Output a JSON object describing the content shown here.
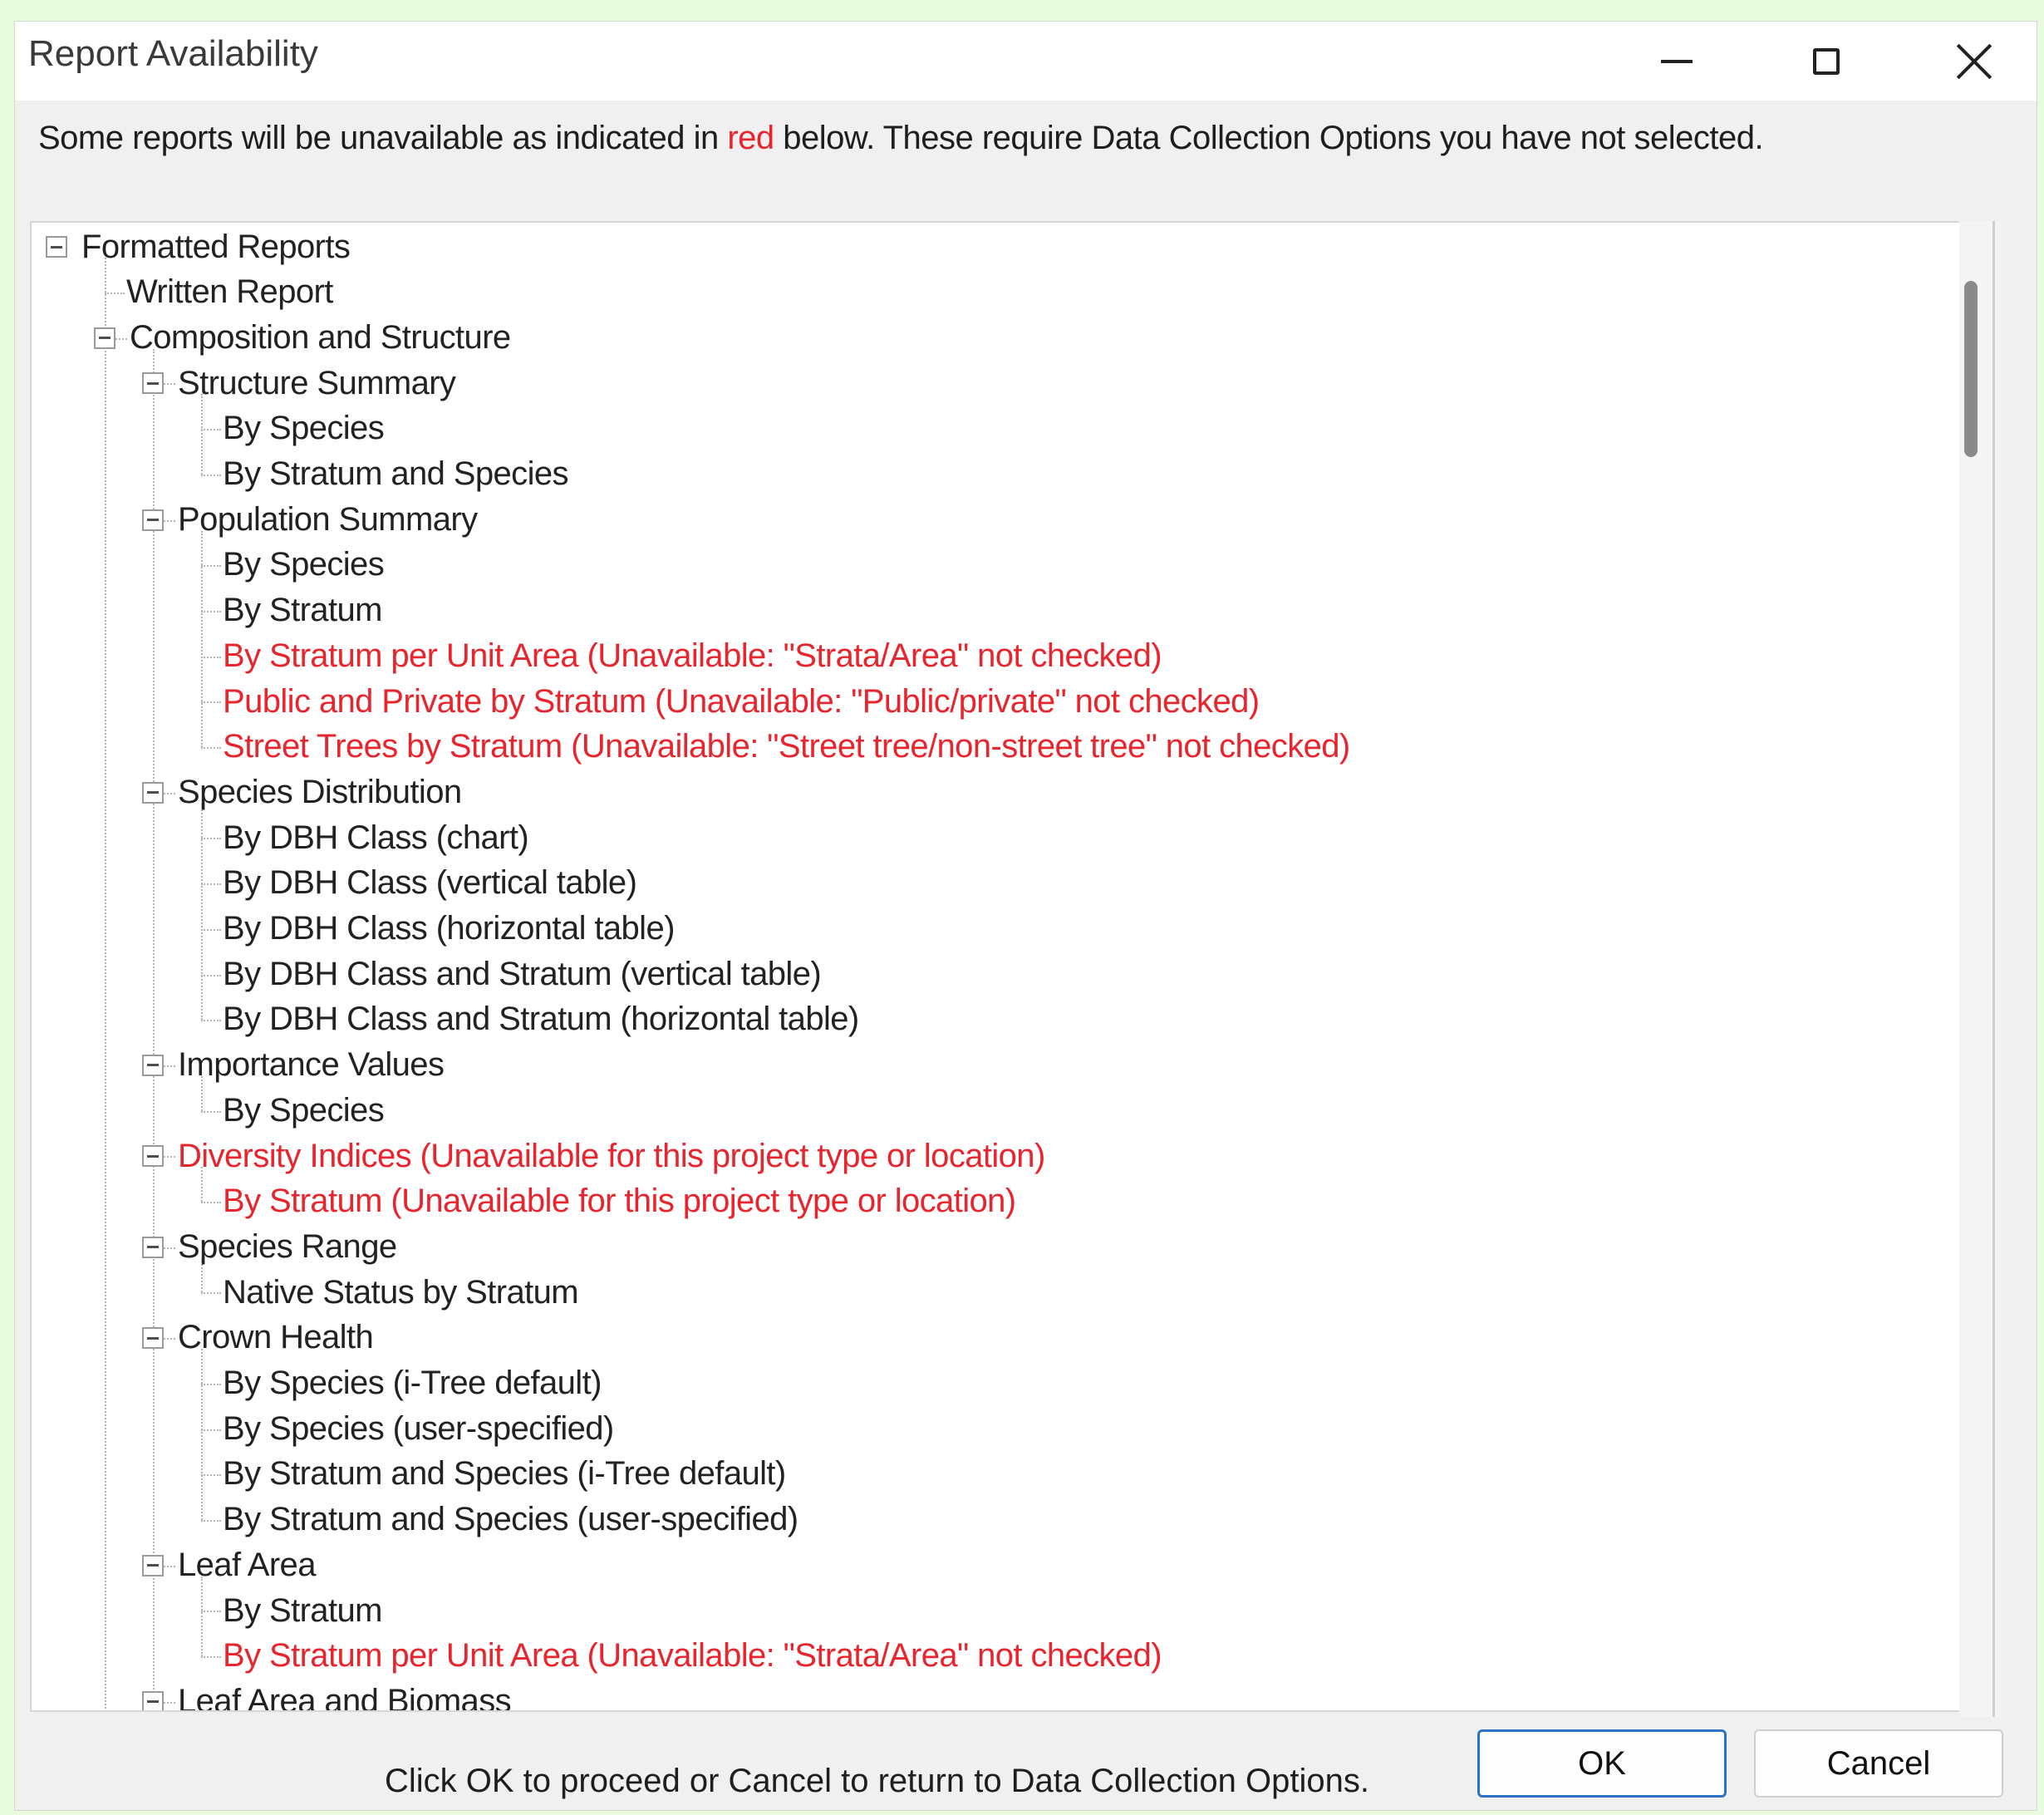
{
  "window": {
    "title": "Report Availability",
    "controls": {
      "minimize_icon": "minimize-icon",
      "maximize_icon": "maximize-icon",
      "close_icon": "close-icon"
    }
  },
  "notice": {
    "before": "Some reports will be unavailable as indicated in",
    "red_word": "red",
    "after": "below. These require Data Collection Options you have not selected."
  },
  "tree": [
    {
      "label": "Formatted Reports",
      "level": 0,
      "expander": true,
      "unavailable": false
    },
    {
      "label": "Written Report",
      "level": 1,
      "expander": false,
      "unavailable": false
    },
    {
      "label": "Composition and Structure",
      "level": 1,
      "expander": true,
      "unavailable": false
    },
    {
      "label": "Structure Summary",
      "level": 2,
      "expander": true,
      "unavailable": false
    },
    {
      "label": "By Species",
      "level": 3,
      "expander": false,
      "unavailable": false
    },
    {
      "label": "By Stratum and Species",
      "level": 3,
      "expander": false,
      "unavailable": false
    },
    {
      "label": "Population Summary",
      "level": 2,
      "expander": true,
      "unavailable": false
    },
    {
      "label": "By Species",
      "level": 3,
      "expander": false,
      "unavailable": false
    },
    {
      "label": "By Stratum",
      "level": 3,
      "expander": false,
      "unavailable": false
    },
    {
      "label": "By Stratum per Unit Area (Unavailable: \"Strata/Area\" not checked)",
      "level": 3,
      "expander": false,
      "unavailable": true
    },
    {
      "label": "Public and Private by Stratum (Unavailable: \"Public/private\" not checked)",
      "level": 3,
      "expander": false,
      "unavailable": true
    },
    {
      "label": "Street Trees by Stratum (Unavailable: \"Street tree/non-street tree\" not checked)",
      "level": 3,
      "expander": false,
      "unavailable": true
    },
    {
      "label": "Species Distribution",
      "level": 2,
      "expander": true,
      "unavailable": false
    },
    {
      "label": "By DBH Class (chart)",
      "level": 3,
      "expander": false,
      "unavailable": false
    },
    {
      "label": "By DBH Class (vertical table)",
      "level": 3,
      "expander": false,
      "unavailable": false
    },
    {
      "label": "By DBH Class (horizontal table)",
      "level": 3,
      "expander": false,
      "unavailable": false
    },
    {
      "label": "By DBH Class and Stratum (vertical table)",
      "level": 3,
      "expander": false,
      "unavailable": false
    },
    {
      "label": "By DBH Class and Stratum (horizontal table)",
      "level": 3,
      "expander": false,
      "unavailable": false
    },
    {
      "label": "Importance Values",
      "level": 2,
      "expander": true,
      "unavailable": false
    },
    {
      "label": "By Species",
      "level": 3,
      "expander": false,
      "unavailable": false
    },
    {
      "label": "Diversity Indices (Unavailable for this project type or location)",
      "level": 2,
      "expander": true,
      "unavailable": true
    },
    {
      "label": "By Stratum (Unavailable for this project type or location)",
      "level": 3,
      "expander": false,
      "unavailable": true
    },
    {
      "label": "Species Range",
      "level": 2,
      "expander": true,
      "unavailable": false
    },
    {
      "label": "Native Status by Stratum",
      "level": 3,
      "expander": false,
      "unavailable": false
    },
    {
      "label": "Crown Health",
      "level": 2,
      "expander": true,
      "unavailable": false
    },
    {
      "label": "By Species (i-Tree default)",
      "level": 3,
      "expander": false,
      "unavailable": false
    },
    {
      "label": "By Species (user-specified)",
      "level": 3,
      "expander": false,
      "unavailable": false
    },
    {
      "label": "By Stratum and Species (i-Tree default)",
      "level": 3,
      "expander": false,
      "unavailable": false
    },
    {
      "label": "By Stratum and Species (user-specified)",
      "level": 3,
      "expander": false,
      "unavailable": false
    },
    {
      "label": "Leaf Area",
      "level": 2,
      "expander": true,
      "unavailable": false
    },
    {
      "label": "By Stratum",
      "level": 3,
      "expander": false,
      "unavailable": false
    },
    {
      "label": "By Stratum per Unit Area (Unavailable: \"Strata/Area\" not checked)",
      "level": 3,
      "expander": false,
      "unavailable": true
    },
    {
      "label": "Leaf Area and Biomass",
      "level": 2,
      "expander": true,
      "unavailable": false
    }
  ],
  "footer": {
    "message": "Click OK to proceed or Cancel to return to Data Collection Options.",
    "ok_label": "OK",
    "cancel_label": "Cancel"
  },
  "colors": {
    "unavailable": "#e8242d",
    "background": "#eafce0"
  }
}
